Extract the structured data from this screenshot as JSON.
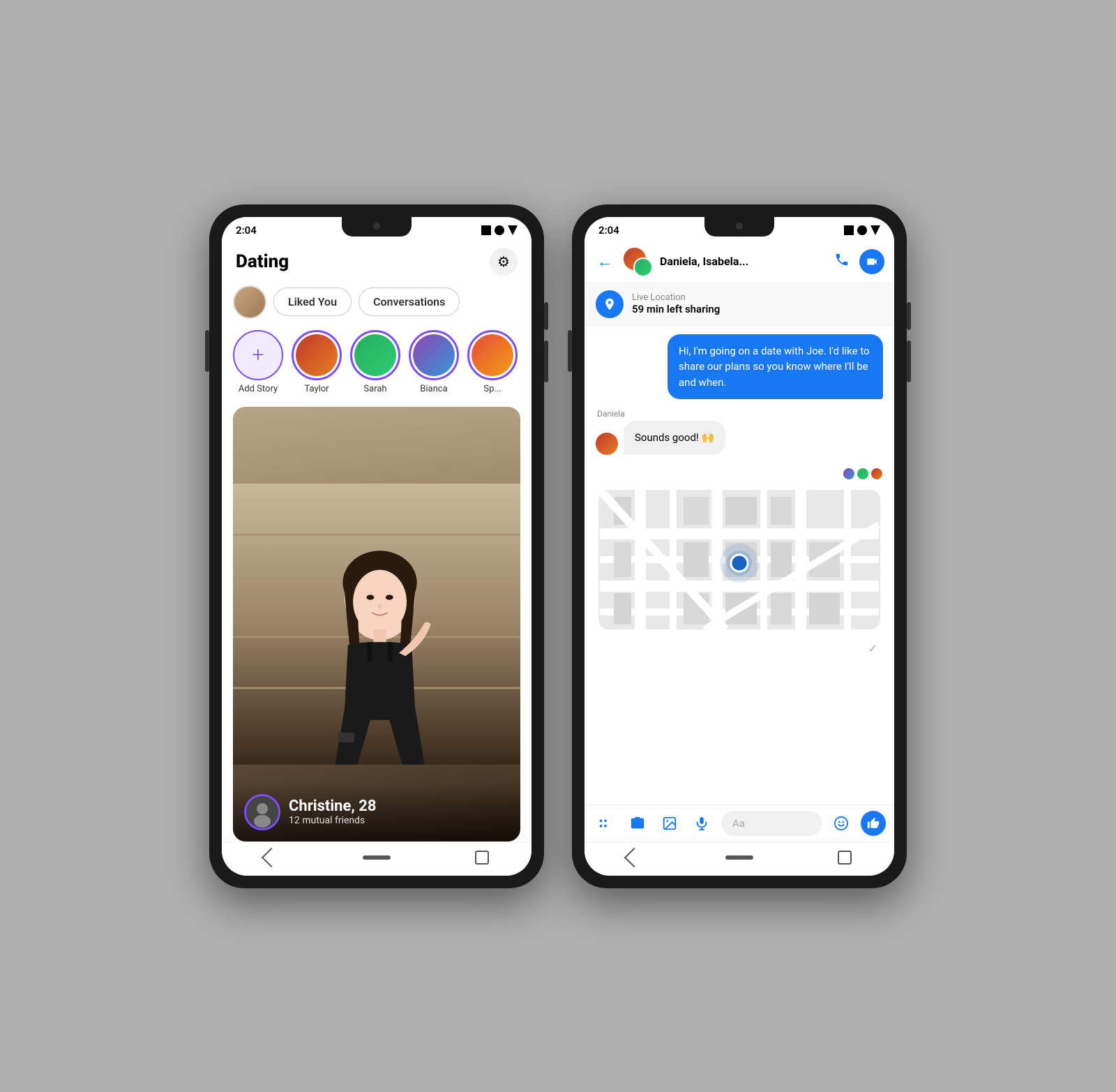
{
  "phone1": {
    "status_time": "2:04",
    "app_title": "Dating",
    "settings_label": "⚙",
    "liked_you_tab": "Liked You",
    "conversations_tab": "Conversations",
    "stories": [
      {
        "id": "add-story",
        "label": "Add Story",
        "type": "add"
      },
      {
        "id": "taylor",
        "label": "Taylor",
        "type": "person",
        "color1": "#c0392b",
        "color2": "#e67e22"
      },
      {
        "id": "sarah",
        "label": "Sarah",
        "type": "person",
        "color1": "#27ae60",
        "color2": "#2ecc71"
      },
      {
        "id": "bianca",
        "label": "Bianca",
        "type": "person",
        "color1": "#8e44ad",
        "color2": "#3498db"
      },
      {
        "id": "sp",
        "label": "Sp...",
        "type": "person",
        "color1": "#e74c3c",
        "color2": "#f39c12"
      }
    ],
    "profile_card": {
      "name": "Christine, 28",
      "sub": "12 mutual friends"
    }
  },
  "phone2": {
    "status_time": "2:04",
    "header_name": "Daniela, Isabela...",
    "live_location_label": "Live Location",
    "live_location_sub": "59 min left sharing",
    "message_out": "Hi, I'm going on a date with Joe. I'd like to share our plans so you know where I'll be and when.",
    "message_sender": "Daniela",
    "message_in": "Sounds good! 🙌",
    "input_placeholder": "Aa",
    "icons": {
      "back": "←",
      "phone": "📞",
      "video": "📹",
      "location": "➤",
      "grid": "⠿",
      "camera": "📷",
      "image": "🖼",
      "mic": "🎙",
      "emoji": "😊",
      "like": "👍"
    }
  }
}
